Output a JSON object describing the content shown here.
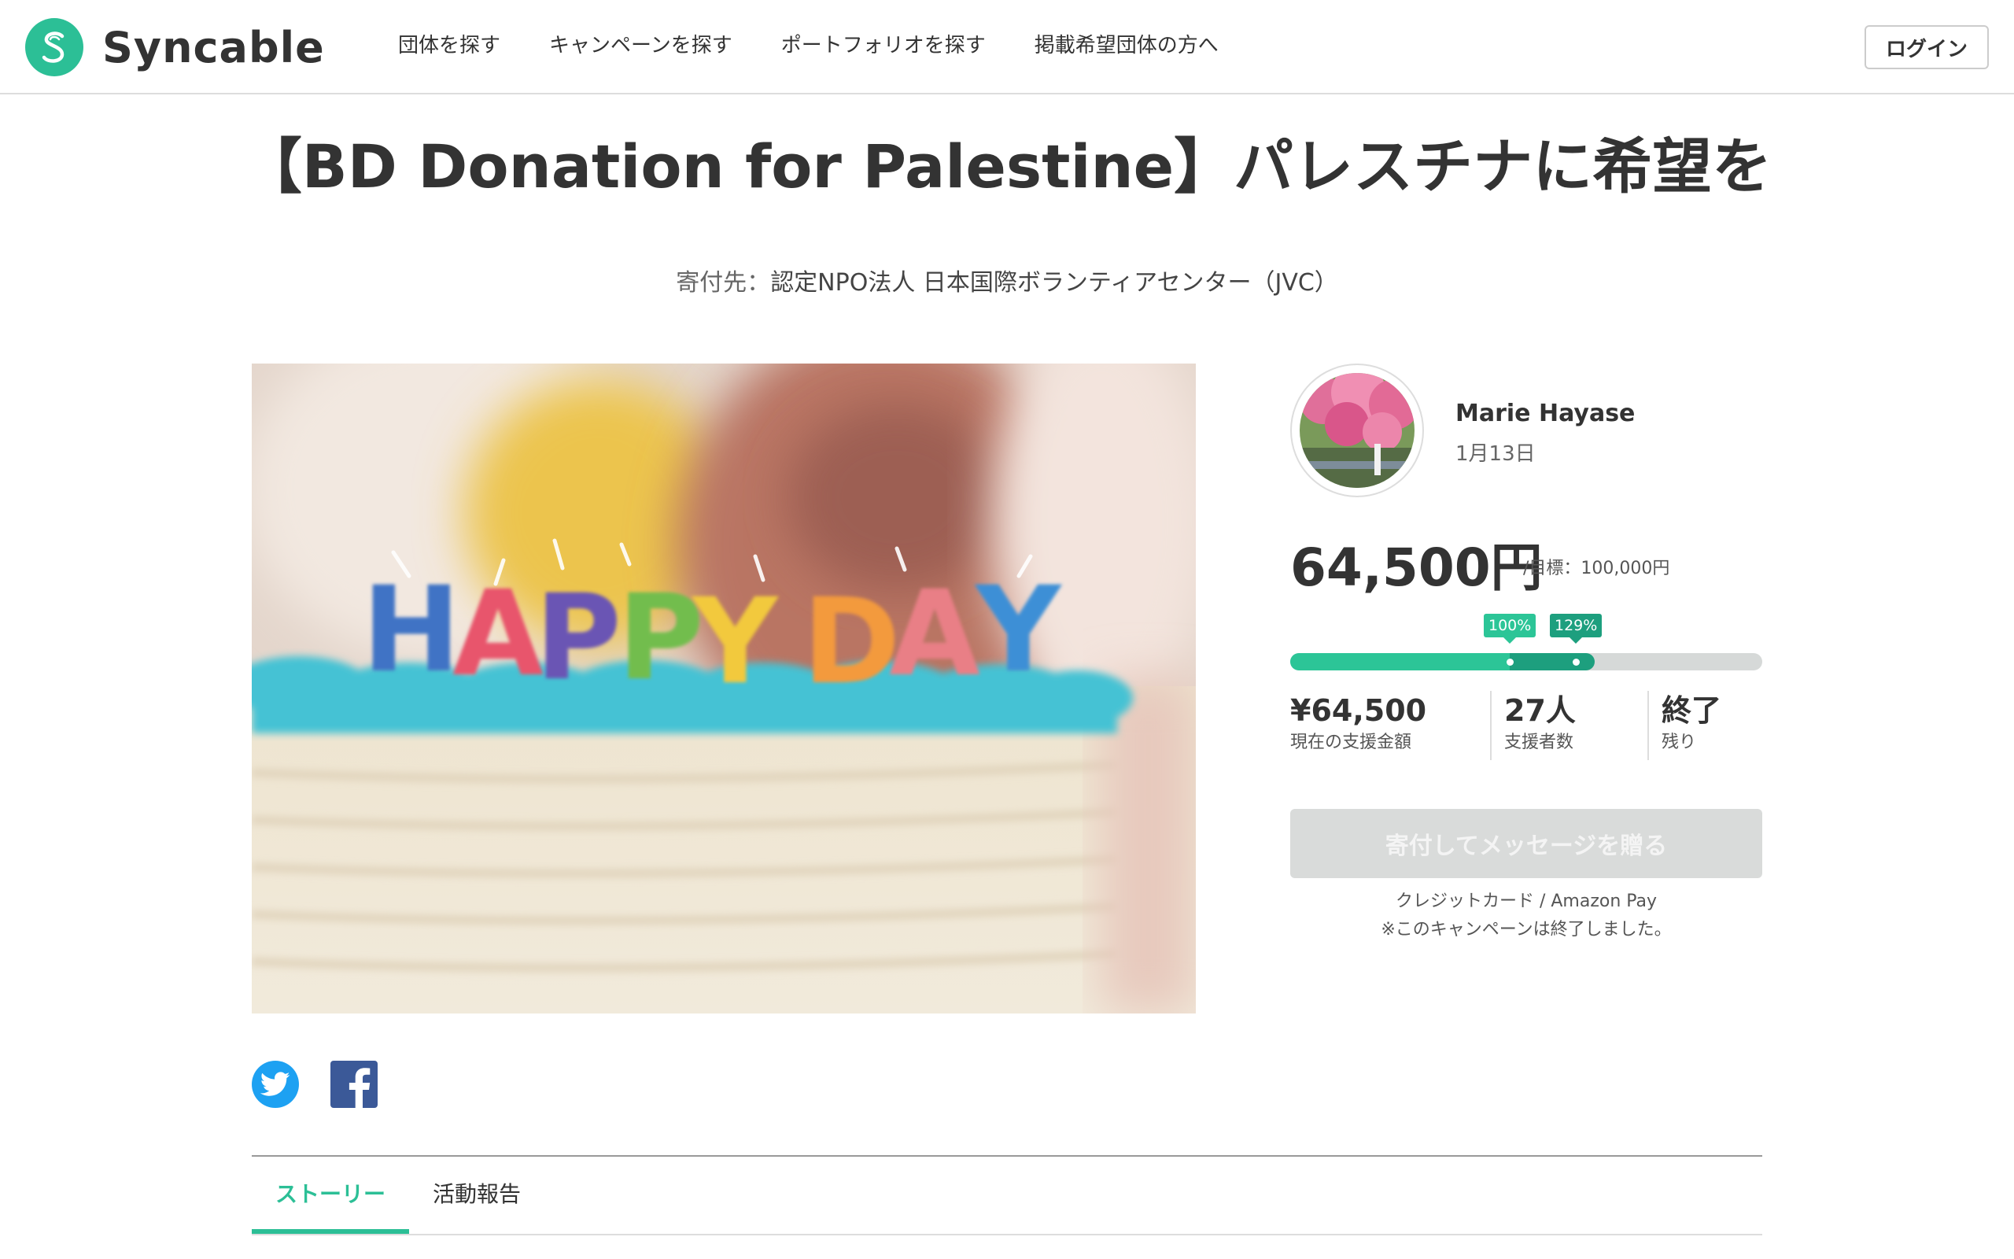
{
  "header": {
    "logo_text": "Syncable",
    "nav": [
      "団体を探す",
      "キャンペーンを探す",
      "ポートフォリオを探す",
      "掲載希望団体の方へ"
    ],
    "login_label": "ログイン"
  },
  "campaign": {
    "title": "【BD Donation for Palestine】パレスチナに希望を",
    "recipient_label": "寄付先：",
    "recipient_name": "認定NPO法人 日本国際ボランティアセンター（JVC）"
  },
  "hero": {
    "candle_letters": "HAPPY DAY"
  },
  "author": {
    "name": "Marie Hayase",
    "date": "1月13日"
  },
  "funding": {
    "amount": "64,500円",
    "goal_text": "/目標：100,000円",
    "progress_percent": 64.5,
    "tags": [
      {
        "label": "100%",
        "position_percent": 46.5
      },
      {
        "label": "129%",
        "position_percent": 60.5
      }
    ]
  },
  "stats": [
    {
      "value": "¥64,500",
      "label": "現在の支援金額"
    },
    {
      "value": "27人",
      "label": "支援者数"
    },
    {
      "value": "終了",
      "label": "残り"
    }
  ],
  "donate": {
    "button_label": "寄付してメッセージを贈る",
    "payment_methods": "クレジットカード / Amazon Pay",
    "ended_note": "※このキャンペーンは終了しました。"
  },
  "tabs": [
    {
      "label": "ストーリー",
      "active": true
    },
    {
      "label": "活動報告",
      "active": false
    }
  ],
  "colors": {
    "brand": "#2cbf96",
    "progress_primary": "#2cc597",
    "progress_secondary": "#1d9f7e",
    "twitter": "#1da1f2",
    "facebook": "#3b5998",
    "disabled_button": "#d9dbda"
  },
  "icons": {
    "logo": "syncable-s-logo-icon",
    "twitter": "twitter-bird-icon",
    "facebook": "facebook-f-icon"
  }
}
